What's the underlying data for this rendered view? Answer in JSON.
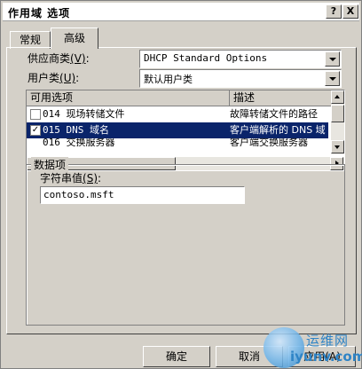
{
  "window": {
    "title": "作用域 选项",
    "help_glyph": "?",
    "close_glyph": "X"
  },
  "tabs": [
    {
      "label": "常规",
      "active": false
    },
    {
      "label": "高级",
      "active": true
    }
  ],
  "vendor_class": {
    "label_text": "供应商类",
    "label_key": "(V)",
    "label_colon": ":",
    "value": "DHCP Standard Options"
  },
  "user_class": {
    "label_text": "用户类",
    "label_key": "(U)",
    "label_colon": ":",
    "value": "默认用户类"
  },
  "options_list": {
    "columns": [
      "可用选项",
      "描述"
    ],
    "rows": [
      {
        "option": "014 现场转储文件",
        "description": "故障转储文件的路径",
        "checked": false,
        "selected": false
      },
      {
        "option": "015 DNS 域名",
        "description": "客户端解析的 DNS 域",
        "checked": true,
        "selected": true
      },
      {
        "option": "016 交换服务器",
        "description": "客户端交换服务器",
        "checked": false,
        "selected": false
      }
    ]
  },
  "data_entry": {
    "group_title": "数据项",
    "string_label_text": "字符串值",
    "string_label_key": "(S)",
    "string_label_colon": ":",
    "string_value": "contoso.msft"
  },
  "buttons": {
    "ok": "确定",
    "cancel": "取消",
    "apply": "应用(A)"
  },
  "watermark": {
    "text_cn": "运维网",
    "domain": "iyunv.com"
  },
  "colors": {
    "selection": "#0a246a",
    "dialog_bg": "#d4d0c8",
    "watermark": "#2f84c6"
  }
}
